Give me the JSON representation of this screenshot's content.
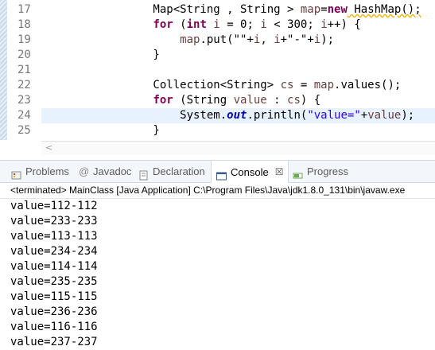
{
  "editor": {
    "lines": [
      {
        "n": "17",
        "segments": [
          {
            "t": "        Map<String , String > ",
            "c": ""
          },
          {
            "t": "map",
            "c": "var"
          },
          {
            "t": "=",
            "c": ""
          },
          {
            "t": "new",
            "c": "kw"
          },
          {
            "t": " HashMap();",
            "c": ""
          }
        ]
      },
      {
        "n": "18",
        "segments": [
          {
            "t": "        ",
            "c": ""
          },
          {
            "t": "for",
            "c": "kw"
          },
          {
            "t": " (",
            "c": ""
          },
          {
            "t": "int",
            "c": "kw"
          },
          {
            "t": " ",
            "c": ""
          },
          {
            "t": "i",
            "c": "var"
          },
          {
            "t": " = 0; ",
            "c": ""
          },
          {
            "t": "i",
            "c": "var"
          },
          {
            "t": " < 300; ",
            "c": ""
          },
          {
            "t": "i",
            "c": "var"
          },
          {
            "t": "++) {",
            "c": ""
          }
        ]
      },
      {
        "n": "19",
        "segments": [
          {
            "t": "            ",
            "c": ""
          },
          {
            "t": "map",
            "c": "var"
          },
          {
            "t": ".put(\"\"+",
            "c": ""
          },
          {
            "t": "i",
            "c": "var"
          },
          {
            "t": ", ",
            "c": ""
          },
          {
            "t": "i",
            "c": "var"
          },
          {
            "t": "+\"-\"+",
            "c": ""
          },
          {
            "t": "i",
            "c": "var"
          },
          {
            "t": ");",
            "c": ""
          }
        ]
      },
      {
        "n": "20",
        "segments": [
          {
            "t": "        }",
            "c": ""
          }
        ]
      },
      {
        "n": "21",
        "segments": [
          {
            "t": "",
            "c": ""
          }
        ]
      },
      {
        "n": "22",
        "segments": [
          {
            "t": "        Collection<String> ",
            "c": ""
          },
          {
            "t": "cs",
            "c": "var"
          },
          {
            "t": " = ",
            "c": ""
          },
          {
            "t": "map",
            "c": "var"
          },
          {
            "t": ".values();",
            "c": ""
          }
        ]
      },
      {
        "n": "23",
        "segments": [
          {
            "t": "        ",
            "c": ""
          },
          {
            "t": "for",
            "c": "kw"
          },
          {
            "t": " (String ",
            "c": ""
          },
          {
            "t": "value",
            "c": "var"
          },
          {
            "t": " : ",
            "c": ""
          },
          {
            "t": "cs",
            "c": "var"
          },
          {
            "t": ") {",
            "c": ""
          }
        ]
      },
      {
        "n": "24",
        "segments": [
          {
            "t": "            System.",
            "c": ""
          },
          {
            "t": "out",
            "c": "stat"
          },
          {
            "t": ".println(",
            "c": ""
          },
          {
            "t": "\"value=\"",
            "c": "str"
          },
          {
            "t": "+",
            "c": ""
          },
          {
            "t": "value",
            "c": "var"
          },
          {
            "t": ");",
            "c": ""
          }
        ]
      },
      {
        "n": "25",
        "segments": [
          {
            "t": "        }",
            "c": ""
          }
        ]
      }
    ],
    "active_line": "24",
    "scroll_arrow": "<"
  },
  "tabs": [
    {
      "label": "Problems",
      "icon": "problems-icon",
      "active": false
    },
    {
      "label": "Javadoc",
      "icon": "javadoc-icon",
      "active": false
    },
    {
      "label": "Declaration",
      "icon": "declaration-icon",
      "active": false
    },
    {
      "label": "Console",
      "icon": "console-icon",
      "active": true,
      "close": "☒"
    },
    {
      "label": "Progress",
      "icon": "progress-icon",
      "active": false
    }
  ],
  "console": {
    "header": "<terminated> MainClass [Java Application] C:\\Program Files\\Java\\jdk1.8.0_131\\bin\\javaw.exe",
    "output": [
      "value=112-112",
      "value=233-233",
      "value=113-113",
      "value=234-234",
      "value=114-114",
      "value=235-235",
      "value=115-115",
      "value=236-236",
      "value=116-116",
      "value=237-237"
    ]
  },
  "colors": {
    "keyword": "#7f0055",
    "variable": "#6a3e3e",
    "string": "#2a00ff",
    "static_field": "#0000c0",
    "active_line_bg": "#e8f2fe"
  }
}
